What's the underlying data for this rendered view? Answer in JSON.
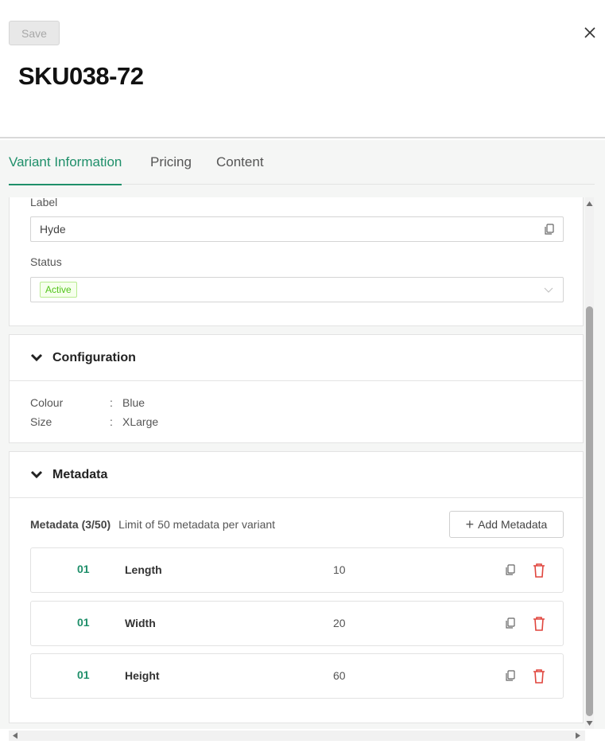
{
  "toolbar": {
    "save_label": "Save"
  },
  "title": "SKU038-72",
  "tabs": [
    {
      "label": "Variant Information",
      "active": true
    },
    {
      "label": "Pricing",
      "active": false
    },
    {
      "label": "Content",
      "active": false
    }
  ],
  "general": {
    "label_field": "Label",
    "label_value": "Hyde",
    "status_field": "Status",
    "status_value": "Active"
  },
  "configuration": {
    "title": "Configuration",
    "rows": [
      {
        "key": "Colour",
        "sep": ":",
        "value": "Blue"
      },
      {
        "key": "Size",
        "sep": ":",
        "value": "XLarge"
      }
    ]
  },
  "metadata": {
    "title": "Metadata",
    "count_label": "Metadata (3/50)",
    "limit_text": "Limit of 50 metadata per variant",
    "add_label": "Add Metadata",
    "items": [
      {
        "index": "01",
        "name": "Length",
        "value": "10"
      },
      {
        "index": "01",
        "name": "Width",
        "value": "20"
      },
      {
        "index": "01",
        "name": "Height",
        "value": "60"
      }
    ]
  },
  "colors": {
    "accent": "#1f8f6a",
    "danger": "#e0453d",
    "status_green": "#52c41a"
  }
}
